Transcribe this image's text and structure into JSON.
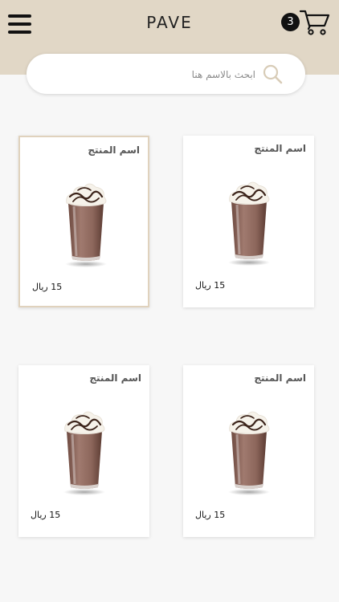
{
  "header": {
    "brand": "PAVE",
    "cart_count": "3"
  },
  "search": {
    "placeholder": "ابحث بالاسم هنا",
    "value": ""
  },
  "products": [
    {
      "name": "اسم المنتج",
      "price": "15 ريال",
      "selected": true
    },
    {
      "name": "اسم المنتج",
      "price": "15 ريال",
      "selected": false
    },
    {
      "name": "اسم المنتج",
      "price": "15 ريال",
      "selected": false
    },
    {
      "name": "اسم المنتج",
      "price": "15 ريال",
      "selected": false
    }
  ],
  "colors": {
    "header_bg": "#e1d7c6",
    "page_bg": "#f7f7f7",
    "card_border_selected": "#e0d2bd",
    "badge_bg": "#111111"
  },
  "icons": {
    "menu": "hamburger-icon",
    "cart": "cart-icon",
    "search": "search-icon",
    "product": "frappe-drink-image"
  }
}
